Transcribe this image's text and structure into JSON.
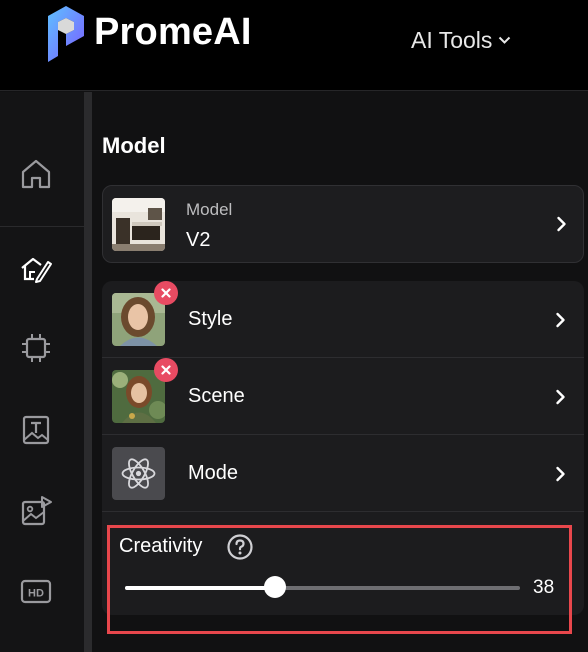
{
  "header": {
    "brand_name": "PromeAI",
    "tools_menu_label": "AI Tools"
  },
  "sidebar": {
    "items": [
      {
        "icon": "home-icon",
        "active": false
      },
      {
        "icon": "house-edit-icon",
        "active": true
      },
      {
        "icon": "chip-icon",
        "active": false
      },
      {
        "icon": "text-image-icon",
        "active": false
      },
      {
        "icon": "image-video-icon",
        "active": false
      },
      {
        "icon": "hd-icon",
        "active": false
      }
    ]
  },
  "panel": {
    "section_title": "Model",
    "model_card": {
      "label": "Model",
      "value": "V2"
    },
    "options": [
      {
        "label": "Style",
        "removable": true,
        "icon": "style-thumbnail"
      },
      {
        "label": "Scene",
        "removable": true,
        "icon": "scene-thumbnail"
      },
      {
        "label": "Mode",
        "removable": false,
        "icon": "atom-icon"
      }
    ],
    "creativity": {
      "label": "Creativity",
      "value": "38",
      "level": 0.38
    }
  },
  "colors": {
    "background": "#111112",
    "card": "#1d1d1f",
    "remove_badge": "#e84b62",
    "highlight_border": "#e8474c",
    "logo_gradient": [
      "#6aa8ff",
      "#7b5cff"
    ]
  }
}
